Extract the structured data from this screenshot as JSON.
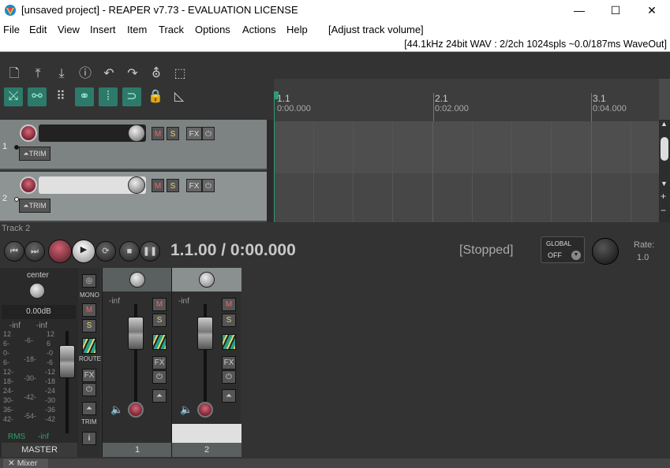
{
  "window": {
    "title": "[unsaved project] - REAPER v7.73 - EVALUATION LICENSE",
    "minimize": "—",
    "maximize": "☐",
    "close": "✕"
  },
  "menu": {
    "items": [
      "File",
      "Edit",
      "View",
      "Insert",
      "Item",
      "Track",
      "Options",
      "Actions",
      "Help"
    ],
    "action_hint": "[Adjust track volume]",
    "audio_status": "[44.1kHz 24bit WAV : 2/2ch 1024spls ~0.0/187ms WaveOut]"
  },
  "toolbar": {
    "icons": [
      "new-project-icon",
      "save-icon",
      "load-icon",
      "info-icon",
      "undo-icon",
      "redo-icon",
      "metronome-icon",
      "grid-icon"
    ],
    "toggles": [
      "ripple-icon",
      "link-icon",
      "grid-snap-icon",
      "group-icon",
      "crossfade-icon",
      "loop-icon",
      "lock-icon",
      "envelope-icon"
    ]
  },
  "tracks": [
    {
      "number": "1",
      "m": "M",
      "s": "S",
      "fx": "FX",
      "pw": "⏻",
      "trim": "TRIM"
    },
    {
      "number": "2",
      "m": "M",
      "s": "S",
      "fx": "FX",
      "pw": "⏻",
      "trim": "TRIM"
    }
  ],
  "ruler": {
    "marks": [
      {
        "bar": "1.1",
        "time": "0:00.000"
      },
      {
        "bar": "2.1",
        "time": "0:02.000"
      },
      {
        "bar": "3.1",
        "time": "0:04.000"
      }
    ]
  },
  "transport": {
    "track_label": "Track 2",
    "position": "1.1.00 / 0:00.000",
    "state": "[Stopped]",
    "global_label": "GLOBAL",
    "global_state": "OFF",
    "rate_label": "Rate:",
    "rate_value": "1.0"
  },
  "master": {
    "pan": "center",
    "mono": "MONO",
    "m": "M",
    "s": "S",
    "route": "ROUTE",
    "fx": "FX",
    "pw": "⏻",
    "trim": "TRIM",
    "info": "i",
    "volume": "0.00dB",
    "left_peak": "-inf",
    "right_peak": "-inf",
    "scale_left": [
      "12",
      "6-",
      "0-",
      "6-",
      "12-",
      "18-",
      "24-",
      "30-",
      "36-",
      "42-"
    ],
    "scale_mid": [
      "-6-",
      "-18-",
      "-30-",
      "-42-",
      "-54-"
    ],
    "scale_right": [
      "12",
      "6",
      "-0",
      "-6",
      "-12",
      "-18",
      "-24",
      "-30",
      "-36",
      "-42"
    ],
    "rms_label": "RMS",
    "rms_value": "-inf",
    "name": "MASTER"
  },
  "mixer_strips": [
    {
      "number": "1",
      "peak": "-inf",
      "m": "M",
      "s": "S",
      "fx": "FX",
      "pw": "⏻"
    },
    {
      "number": "2",
      "peak": "-inf",
      "m": "M",
      "s": "S",
      "fx": "FX",
      "pw": "⏻"
    }
  ],
  "bottom_tab": {
    "label": "Mixer"
  },
  "colors": {
    "accent": "#2d7a6a",
    "mute": "#e66666",
    "solo": "#e8d96a",
    "record": "#7a2233"
  }
}
